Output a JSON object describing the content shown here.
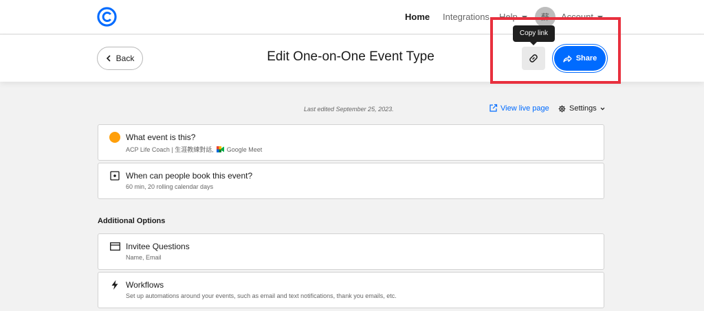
{
  "nav": {
    "home": "Home",
    "integrations": "Integrations",
    "help": "Help",
    "avatar_initial": "蘇",
    "account": "Account"
  },
  "header": {
    "back_label": "Back",
    "title": "Edit One-on-One Event Type",
    "copy_link_tooltip": "Copy link",
    "share_label": "Share"
  },
  "meta": {
    "last_edited": "Last edited September 25, 2023.",
    "view_live_page": "View live page",
    "settings": "Settings"
  },
  "cards": [
    {
      "title": "What event is this?",
      "subtitle": "ACP Life Coach | 生涯教練對話,",
      "location": "Google Meet",
      "icon": "orange-dot"
    },
    {
      "title": "When can people book this event?",
      "subtitle": "60 min, 20 rolling calendar days",
      "icon": "calendar-icon"
    }
  ],
  "additional_options": {
    "heading": "Additional Options",
    "items": [
      {
        "title": "Invitee Questions",
        "subtitle": "Name, Email",
        "icon": "form-icon"
      },
      {
        "title": "Workflows",
        "subtitle": "Set up automations around your events, such as email and text notifications, thank you emails, etc.",
        "icon": "lightning-icon"
      }
    ]
  },
  "colors": {
    "brand_blue": "#006bff",
    "event_color": "#ff9f0a",
    "highlight_red": "#e8303e"
  }
}
